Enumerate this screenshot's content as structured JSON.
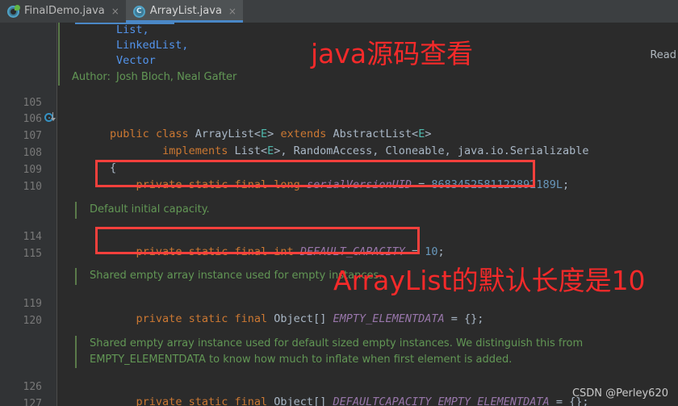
{
  "window": {
    "theme_background": "#2b2b2b",
    "readonly_label": "Read"
  },
  "tabs": [
    {
      "label": "FinalDemo.java",
      "icon": "java-file-icon",
      "close": "×",
      "active": false
    },
    {
      "label": "ArrayList.java",
      "icon": "java-class-icon",
      "close": "×",
      "active": true
    }
  ],
  "gutter": {
    "line_numbers": [
      "105",
      "106",
      "107",
      "108",
      "109",
      "110",
      "114",
      "115",
      "119",
      "120",
      "126",
      "127"
    ],
    "marker_line": "106",
    "marker_icon": "implemented-method-icon"
  },
  "javadoc_top": {
    "links": [
      "List,",
      "LinkedList,",
      "Vector"
    ],
    "author_tag": "Author:",
    "author_value": "Josh Bloch, Neal Gafter"
  },
  "code_lines": [
    {
      "line": "106",
      "tokens": [
        {
          "t": "public",
          "c": "kw"
        },
        {
          "t": " ",
          "c": "punc"
        },
        {
          "t": "class",
          "c": "kw"
        },
        {
          "t": " ",
          "c": "punc"
        },
        {
          "t": "ArrayList",
          "c": "cls"
        },
        {
          "t": "<",
          "c": "punc"
        },
        {
          "t": "E",
          "c": "gen"
        },
        {
          "t": ">",
          "c": "punc"
        },
        {
          "t": " ",
          "c": "punc"
        },
        {
          "t": "extends",
          "c": "kw"
        },
        {
          "t": " ",
          "c": "punc"
        },
        {
          "t": "AbstractList",
          "c": "cls"
        },
        {
          "t": "<",
          "c": "punc"
        },
        {
          "t": "E",
          "c": "gen"
        },
        {
          "t": ">",
          "c": "punc"
        }
      ]
    },
    {
      "line": "107",
      "tokens": [
        {
          "t": "        ",
          "c": "punc"
        },
        {
          "t": "implements",
          "c": "kw"
        },
        {
          "t": " ",
          "c": "punc"
        },
        {
          "t": "List",
          "c": "cls"
        },
        {
          "t": "<",
          "c": "punc"
        },
        {
          "t": "E",
          "c": "gen"
        },
        {
          "t": ">, ",
          "c": "punc"
        },
        {
          "t": "RandomAccess",
          "c": "cls"
        },
        {
          "t": ", ",
          "c": "punc"
        },
        {
          "t": "Cloneable",
          "c": "cls"
        },
        {
          "t": ", ",
          "c": "punc"
        },
        {
          "t": "java.io.Serializable",
          "c": "cls"
        }
      ]
    },
    {
      "line": "108",
      "tokens": [
        {
          "t": "{",
          "c": "punc"
        }
      ]
    },
    {
      "line": "109",
      "tokens": [
        {
          "t": "    ",
          "c": "punc"
        },
        {
          "t": "private",
          "c": "kw"
        },
        {
          "t": " ",
          "c": "punc"
        },
        {
          "t": "static",
          "c": "kw"
        },
        {
          "t": " ",
          "c": "punc"
        },
        {
          "t": "final",
          "c": "kw"
        },
        {
          "t": " ",
          "c": "punc"
        },
        {
          "t": "long",
          "c": "kw"
        },
        {
          "t": " ",
          "c": "punc"
        },
        {
          "t": "serialVersionUID",
          "c": "fld"
        },
        {
          "t": " = ",
          "c": "punc"
        },
        {
          "t": "8683452581122892189L",
          "c": "num"
        },
        {
          "t": ";",
          "c": "punc"
        }
      ]
    },
    {
      "line": "114",
      "tokens": [
        {
          "t": "    ",
          "c": "punc"
        },
        {
          "t": "private",
          "c": "kw"
        },
        {
          "t": " ",
          "c": "punc"
        },
        {
          "t": "static",
          "c": "kw"
        },
        {
          "t": " ",
          "c": "punc"
        },
        {
          "t": "final",
          "c": "kw"
        },
        {
          "t": " ",
          "c": "punc"
        },
        {
          "t": "int",
          "c": "kw"
        },
        {
          "t": " ",
          "c": "punc"
        },
        {
          "t": "DEFAULT_CAPACITY",
          "c": "fld"
        },
        {
          "t": " = ",
          "c": "punc"
        },
        {
          "t": "10",
          "c": "num"
        },
        {
          "t": ";",
          "c": "punc"
        }
      ]
    },
    {
      "line": "119",
      "tokens": [
        {
          "t": "    ",
          "c": "punc"
        },
        {
          "t": "private",
          "c": "kw"
        },
        {
          "t": " ",
          "c": "punc"
        },
        {
          "t": "static",
          "c": "kw"
        },
        {
          "t": " ",
          "c": "punc"
        },
        {
          "t": "final",
          "c": "kw"
        },
        {
          "t": " ",
          "c": "punc"
        },
        {
          "t": "Object",
          "c": "cls"
        },
        {
          "t": "[] ",
          "c": "punc"
        },
        {
          "t": "EMPTY_ELEMENTDATA",
          "c": "fld"
        },
        {
          "t": " = {};",
          "c": "punc"
        }
      ]
    },
    {
      "line": "126",
      "tokens": [
        {
          "t": "    ",
          "c": "punc"
        },
        {
          "t": "private",
          "c": "kw"
        },
        {
          "t": " ",
          "c": "punc"
        },
        {
          "t": "static",
          "c": "kw"
        },
        {
          "t": " ",
          "c": "punc"
        },
        {
          "t": "final",
          "c": "kw"
        },
        {
          "t": " ",
          "c": "punc"
        },
        {
          "t": "Object",
          "c": "cls"
        },
        {
          "t": "[] ",
          "c": "punc"
        },
        {
          "t": "DEFAULTCAPACITY_EMPTY_ELEMENTDATA",
          "c": "fld"
        },
        {
          "t": " = {};",
          "c": "punc"
        }
      ]
    }
  ],
  "doc_comments": {
    "default_capacity": "Default initial capacity.",
    "empty_elementdata": "Shared empty array instance used for empty instances.",
    "defaultcapacity_line1": "Shared empty array instance used for default sized empty instances. We distinguish this from",
    "defaultcapacity_line2": "EMPTY_ELEMENTDATA to know how much to inflate when first element is added."
  },
  "annotations": [
    {
      "text": "java源码查看",
      "color": "#f42a2a"
    },
    {
      "text": "ArrayList的默认长度是10",
      "color": "#f42a2a"
    }
  ],
  "highlight_boxes": [
    {
      "target": "serialVersionUID line",
      "color": "#f5403c"
    },
    {
      "target": "DEFAULT_CAPACITY line",
      "color": "#f5403c"
    }
  ],
  "watermark": {
    "text": "CSDN @Perley620"
  }
}
